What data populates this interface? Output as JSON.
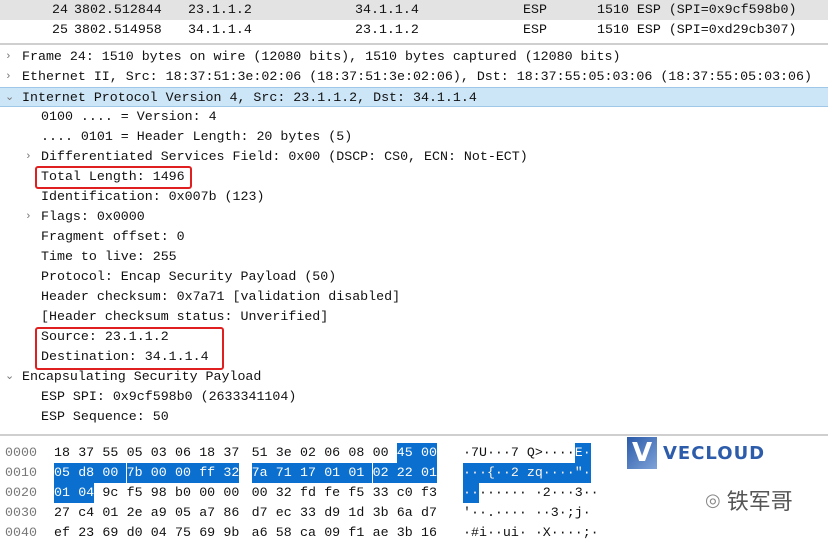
{
  "packets": [
    {
      "no": "24",
      "time": "3802.512844",
      "src": "23.1.1.2",
      "dst": "34.1.1.4",
      "proto": "ESP",
      "info": "1510 ESP (SPI=0x9cf598b0)"
    },
    {
      "no": "25",
      "time": "3802.514958",
      "src": "34.1.1.4",
      "dst": "23.1.1.2",
      "proto": "ESP",
      "info": "1510 ESP (SPI=0xd29cb307)"
    }
  ],
  "details": [
    {
      "text": "Frame 24: 1510 bytes on wire (12080 bits), 1510 bytes captured (12080 bits)",
      "arrow": "›"
    },
    {
      "text": "Ethernet II, Src: 18:37:51:3e:02:06 (18:37:51:3e:02:06), Dst: 18:37:55:05:03:06 (18:37:55:05:03:06)",
      "arrow": "›"
    },
    {
      "text": "Internet Protocol Version 4, Src: 23.1.1.2, Dst: 34.1.1.4",
      "arrow": "⌄"
    },
    {
      "text": "0100 .... = Version: 4"
    },
    {
      "text": ".... 0101 = Header Length: 20 bytes (5)"
    },
    {
      "text": "Differentiated Services Field: 0x00 (DSCP: CS0, ECN: Not-ECT)",
      "arrow": "›"
    },
    {
      "text": "Total Length: 1496"
    },
    {
      "text": "Identification: 0x007b (123)"
    },
    {
      "text": "Flags: 0x0000",
      "arrow": "›"
    },
    {
      "text": "Fragment offset: 0"
    },
    {
      "text": "Time to live: 255"
    },
    {
      "text": "Protocol: Encap Security Payload (50)"
    },
    {
      "text": "Header checksum: 0x7a71 [validation disabled]"
    },
    {
      "text": "[Header checksum status: Unverified]"
    },
    {
      "text": "Source: 23.1.1.2"
    },
    {
      "text": "Destination: 34.1.1.4"
    },
    {
      "text": "Encapsulating Security Payload",
      "arrow": "⌄"
    },
    {
      "text": "ESP SPI: 0x9cf598b0 (2633341104)"
    },
    {
      "text": "ESP Sequence: 50"
    }
  ],
  "hex": [
    {
      "off": "0000",
      "bytes": [
        "18",
        "37",
        "55",
        "05",
        "03",
        "06",
        "18",
        "37",
        "51",
        "3e",
        "02",
        "06",
        "08",
        "00",
        "45",
        "00"
      ],
      "ascii": "·7U···7 Q>····E·"
    },
    {
      "off": "0010",
      "bytes": [
        "05",
        "d8",
        "00",
        "7b",
        "00",
        "00",
        "ff",
        "32",
        "7a",
        "71",
        "17",
        "01",
        "01",
        "02",
        "22",
        "01"
      ],
      "ascii": "···{··2 zq····\"·"
    },
    {
      "off": "0020",
      "bytes": [
        "01",
        "04",
        "9c",
        "f5",
        "98",
        "b0",
        "00",
        "00",
        "00",
        "32",
        "fd",
        "fe",
        "f5",
        "33",
        "c0",
        "f3"
      ],
      "ascii": "········ ·2···3··"
    },
    {
      "off": "0030",
      "bytes": [
        "27",
        "c4",
        "01",
        "2e",
        "a9",
        "05",
        "a7",
        "86",
        "d7",
        "ec",
        "33",
        "d9",
        "1d",
        "3b",
        "6a",
        "d7"
      ],
      "ascii": "'··.···· ··3·;j·"
    },
    {
      "off": "0040",
      "bytes": [
        "ef",
        "23",
        "69",
        "d0",
        "04",
        "75",
        "69",
        "9b",
        "a6",
        "58",
        "ca",
        "09",
        "f1",
        "ae",
        "3b",
        "16"
      ],
      "ascii": "·#i··ui· ·X····;·"
    }
  ],
  "highlight": {
    "start": 14,
    "end": 33,
    "color": "#0a6fcf"
  },
  "watermark": {
    "logo": "VECLOUD",
    "wechat": "铁军哥"
  }
}
